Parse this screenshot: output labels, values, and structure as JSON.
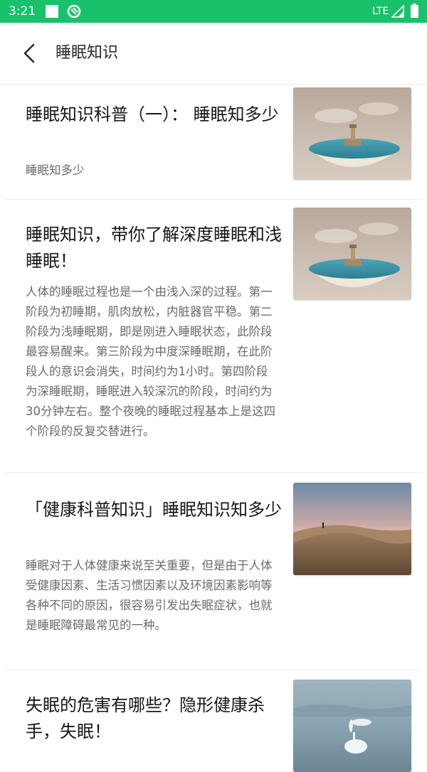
{
  "status_bar": {
    "time": "3:21",
    "network": "LTE",
    "icons": [
      "square-icon",
      "app-notification-icon",
      "signal-icon",
      "battery-icon"
    ]
  },
  "header": {
    "back_icon": "chevron-left-icon",
    "title": "睡眠知识"
  },
  "colors": {
    "status_bar": "#19c16a",
    "title_text": "#161616",
    "summary_text": "#6b6b6b",
    "divider": "#ececec"
  },
  "articles": [
    {
      "title": "睡眠知识科普（一）： 睡眠知多少",
      "summary": "睡眠知多少",
      "thumbnail": "lighthouse-in-bowl-image"
    },
    {
      "title": "睡眠知识，带你了解深度睡眠和浅睡眠！",
      "summary": "人体的睡眠过程也是一个由浅入深的过程。第一阶段为初睡期，肌肉放松，内脏器官平稳。第二阶段为浅睡眠期，即是刚进入睡眠状态，此阶段最容易醒来。第三阶段为中度深睡眠期，在此阶段人的意识会消失，时间约为1小时。第四阶段为深睡眠期，睡眠进入较深沉的阶段，时间约为30分钟左右。整个夜晚的睡眠过程基本上是这四个阶段的反复交替进行。",
      "thumbnail": "lighthouse-in-bowl-image"
    },
    {
      "title": "「健康科普知识」睡眠知识知多少",
      "summary": "睡眠对于人体健康来说至关重要，但是由于人体受健康因素、生活习惯因素以及环境因素影响等各种不同的原因，很容易引发出失眠症状，也就是睡眠障碍最常见的一种。",
      "thumbnail": "desert-dunes-image"
    },
    {
      "title": "失眠的危害有哪些？隐形健康杀手，失眠！",
      "summary": "",
      "thumbnail": "swan-on-lake-image"
    }
  ]
}
